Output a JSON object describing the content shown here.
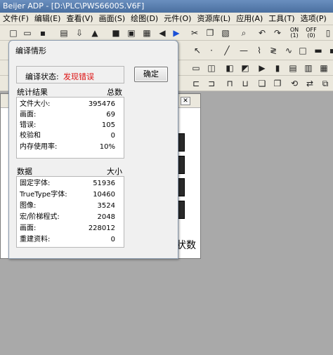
{
  "window": {
    "title": "Beijer ADP - [D:\\PLC\\PWS6600S.V6F]"
  },
  "menu": [
    "文件(F)",
    "编辑(E)",
    "查看(V)",
    "画面(S)",
    "绘图(D)",
    "元件(O)",
    "资源库(L)",
    "应用(A)",
    "工具(T)",
    "选项(P)"
  ],
  "toolbar": {
    "on_label": "ON",
    "on_sub": "(1)",
    "off_label": "OFF",
    "off_sub": "(0)"
  },
  "background_window": {
    "close_glyph": "✕",
    "partial_text": "状数"
  },
  "dialog": {
    "title": "编译情形",
    "status_label": "编译状态:",
    "status_value": "发现错误",
    "status_color": "#dd1111",
    "ok_label": "确定",
    "stats": {
      "header_left": "统计结果",
      "header_right": "总数",
      "rows": [
        {
          "label": "文件大小:",
          "value": "395476"
        },
        {
          "label": "画面:",
          "value": "69"
        },
        {
          "label": "错误:",
          "value": "105"
        },
        {
          "label": "校验和",
          "value": "0"
        },
        {
          "label": "内存使用率:",
          "value": "10%"
        }
      ]
    },
    "data": {
      "header_left": "数据",
      "header_right": "大小",
      "rows": [
        {
          "label": "固定字体:",
          "value": "51936"
        },
        {
          "label": "TrueType字体:",
          "value": "10460"
        },
        {
          "label": "图像:",
          "value": "3524"
        },
        {
          "label": "宏/阶梯程式:",
          "value": "2048"
        },
        {
          "label": "画面:",
          "value": "228012"
        },
        {
          "label": "重建资料:",
          "value": "0"
        }
      ]
    }
  }
}
